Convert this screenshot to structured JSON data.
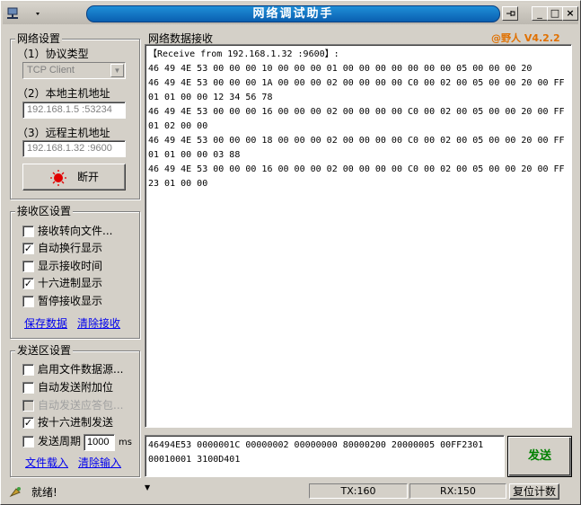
{
  "window": {
    "title": "网络调试助手",
    "version": "@野人 V4.2.2"
  },
  "title_buttons": {
    "minimize": "_",
    "maximize": "□",
    "close": "×"
  },
  "net": {
    "group_label": "网络设置",
    "protocol_label": "（1）协议类型",
    "protocol_value": "TCP Client",
    "local_label": "（2）本地主机地址",
    "local_value": "192.168.1.5 :53234",
    "remote_label": "（3）远程主机地址",
    "remote_value": "192.168.1.32 :9600",
    "connect_button": "断开"
  },
  "recv_settings": {
    "group_label": "接收区设置",
    "options": [
      {
        "label": "接收转向文件...",
        "checked": false
      },
      {
        "label": "自动换行显示",
        "checked": true
      },
      {
        "label": "显示接收时间",
        "checked": false
      },
      {
        "label": "十六进制显示",
        "checked": true
      },
      {
        "label": "暂停接收显示",
        "checked": false
      }
    ],
    "save_link": "保存数据",
    "clear_link": "清除接收"
  },
  "send_settings": {
    "group_label": "发送区设置",
    "options": [
      {
        "label": "启用文件数据源...",
        "checked": false,
        "disabled": false
      },
      {
        "label": "自动发送附加位",
        "checked": false,
        "disabled": false
      },
      {
        "label": "自动发送应答包...",
        "checked": false,
        "disabled": true
      },
      {
        "label": "按十六进制发送",
        "checked": true,
        "disabled": false
      }
    ],
    "period_label": "发送周期",
    "period_value": "1000",
    "period_unit": "ms",
    "load_link": "文件载入",
    "clear_link": "清除输入"
  },
  "recv_area": {
    "group_label": "网络数据接收",
    "lines": [
      "【Receive from 192.168.1.32 :9600】:",
      "46 49 4E 53 00 00 00 10 00 00 00 01 00 00 00 00 00 00 00 05 00 00 00 20",
      "46 49 4E 53 00 00 00 1A 00 00 00 02 00 00 00 00 C0 00 02 00 05 00 00 20 00 FF",
      "01 01 00 00 12 34 56 78",
      "46 49 4E 53 00 00 00 16 00 00 00 02 00 00 00 00 C0 00 02 00 05 00 00 20 00 FF",
      "01 02 00 00",
      "46 49 4E 53 00 00 00 18 00 00 00 02 00 00 00 00 C0 00 02 00 05 00 00 20 00 FF",
      "01 01 00 00 03 88",
      "46 49 4E 53 00 00 00 16 00 00 00 02 00 00 00 00 C0 00 02 00 05 00 00 20 00 FF",
      "23 01 00 00"
    ]
  },
  "send_area": {
    "lines": [
      "46494E53 0000001C 00000002 00000000 80000200 20000005 00FF2301",
      "00010001 3100D401"
    ],
    "send_button": "发送"
  },
  "status_bar": {
    "text": "就绪!",
    "tx": "TX:160",
    "rx": "RX:150",
    "reset_button": "复位计数"
  },
  "colors": {
    "accent_title": "#0a5fb0",
    "version": "#e07000",
    "send_button": "#008000"
  }
}
